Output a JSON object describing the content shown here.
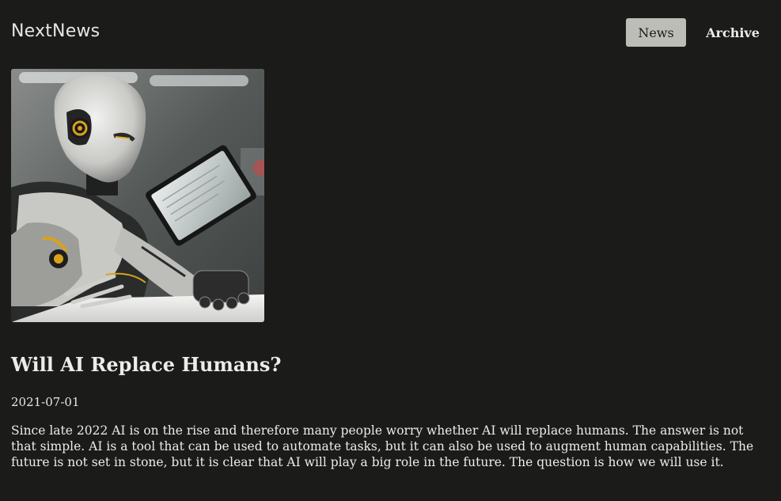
{
  "header": {
    "brand": "NextNews",
    "nav": [
      {
        "label": "News",
        "active": true
      },
      {
        "label": "Archive",
        "active": false
      }
    ]
  },
  "article": {
    "image_icon": "robot-photo",
    "title": "Will AI Replace Humans?",
    "date": "2021-07-01",
    "body": "Since late 2022 AI is on the rise and therefore many people worry whether AI will replace humans. The answer is not that simple. AI is a tool that can be used to automate tasks, but it can also be used to augment human capabilities. The future is not set in stone, but it is clear that AI will play a big role in the future. The question is how we will use it."
  },
  "colors": {
    "background": "#1b1b1a",
    "text": "#ececec",
    "active_nav_bg": "#bdbdb8",
    "accent_gold": "#d9a21b"
  }
}
